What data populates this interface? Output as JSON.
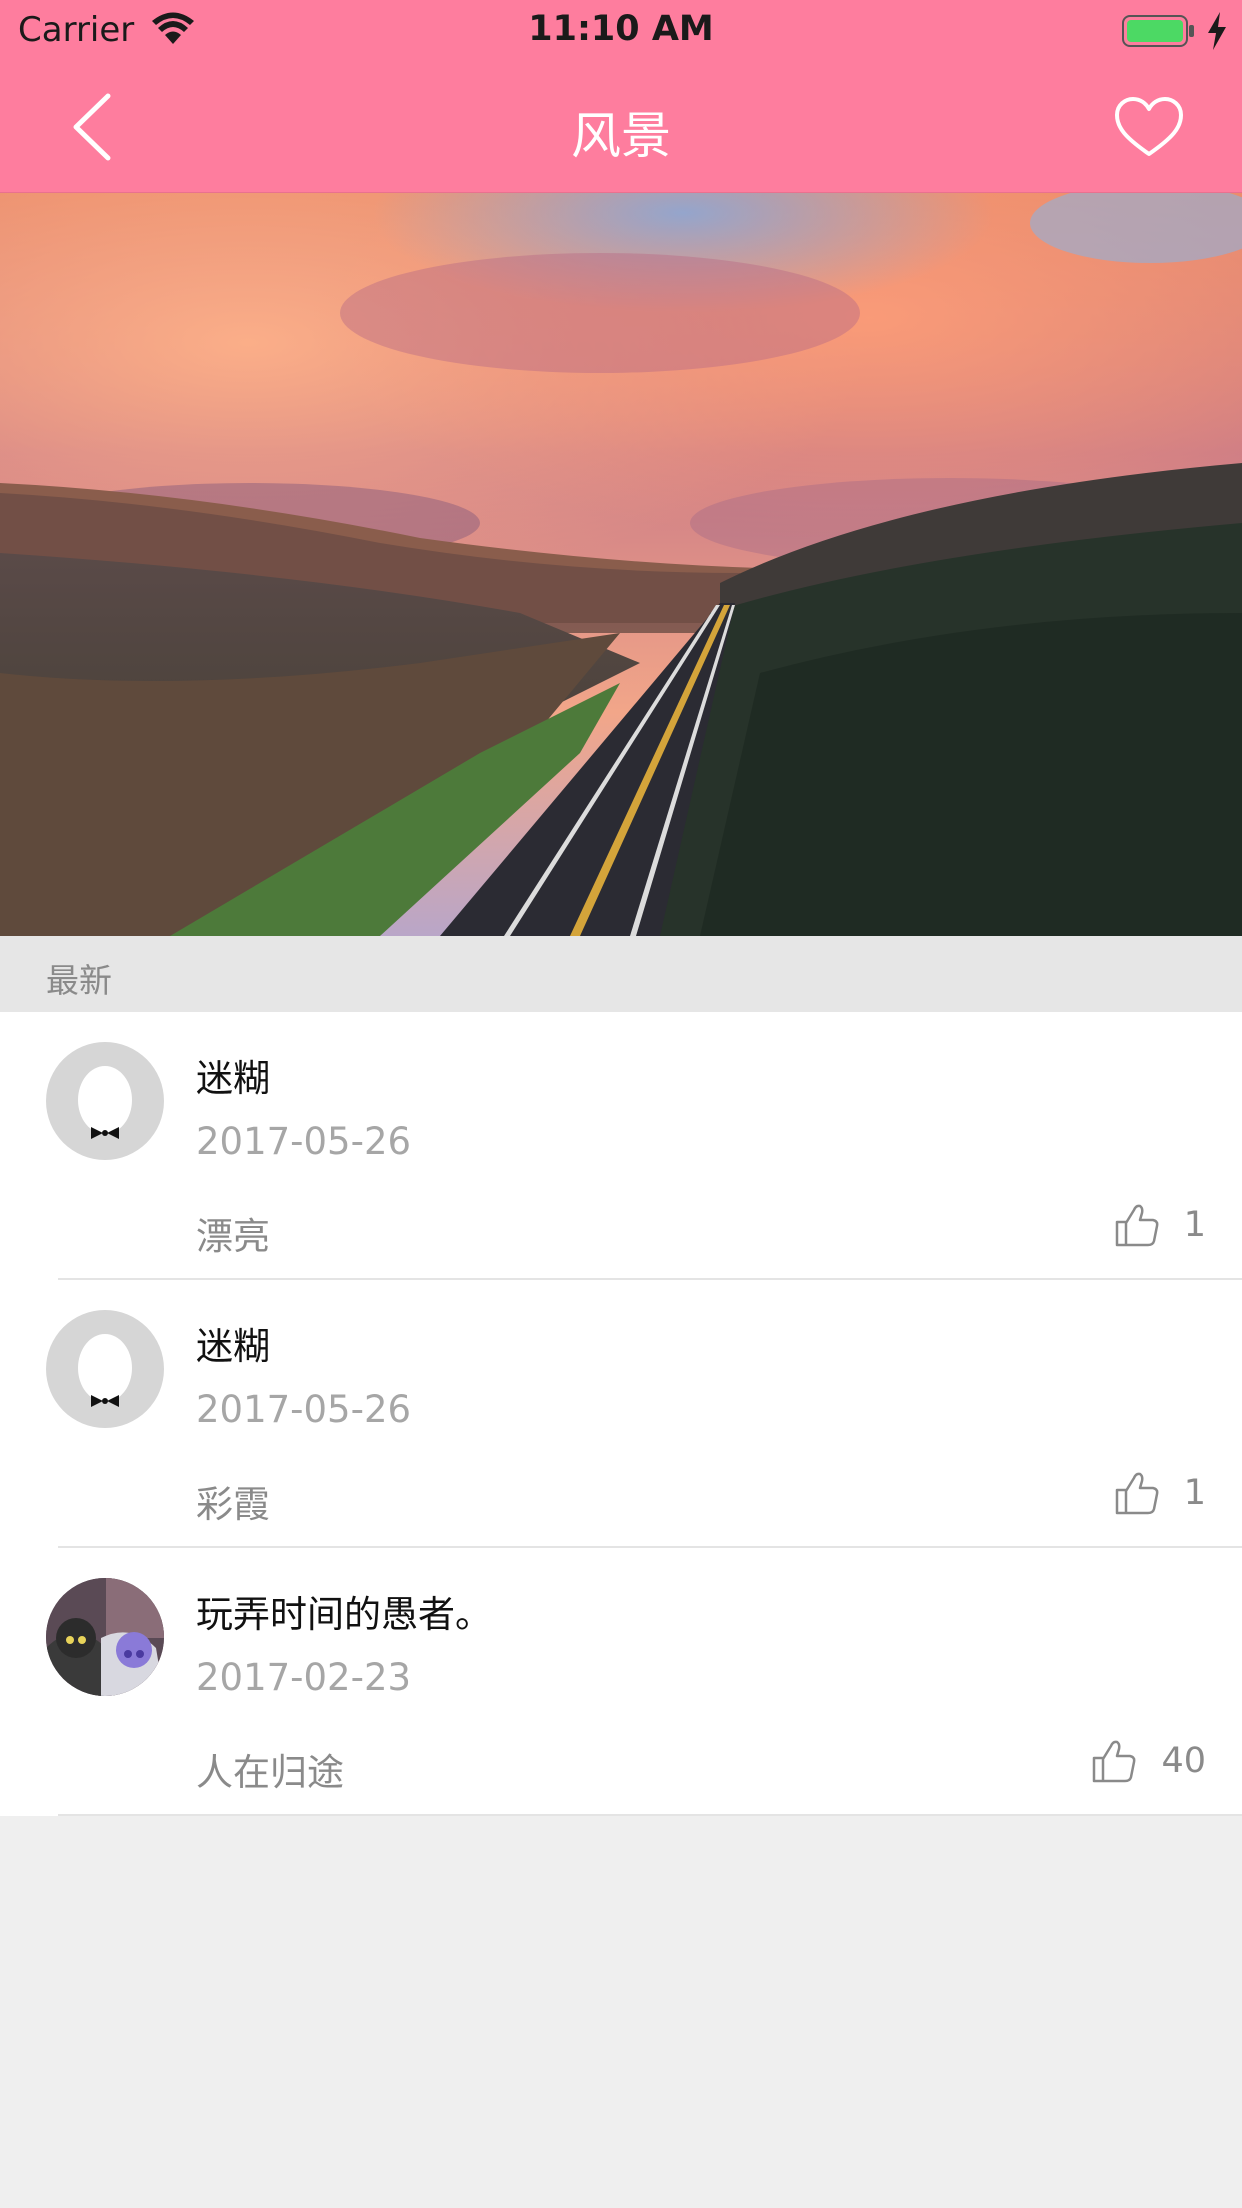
{
  "status_bar": {
    "carrier": "Carrier",
    "time": "11:10 AM"
  },
  "nav": {
    "title": "风景",
    "back_icon": "chevron-left-icon",
    "favorite_icon": "heart-outline-icon"
  },
  "colors": {
    "nav_background": "#fe7d9e",
    "list_background": "#ffffff",
    "page_background": "#efefef",
    "battery_fill": "#4cd964"
  },
  "hero_image": {
    "subject": "landscape-photo"
  },
  "section": {
    "title": "最新"
  },
  "comments": [
    {
      "name": "迷糊",
      "date": "2017-05-26",
      "content": "漂亮",
      "likes": "1",
      "avatar": "default-avatar"
    },
    {
      "name": "迷糊",
      "date": "2017-05-26",
      "content": "彩霞",
      "likes": "1",
      "avatar": "default-avatar"
    },
    {
      "name": "玩弄时间的愚者。",
      "date": "2017-02-23",
      "content": "人在归途",
      "likes": "40",
      "avatar": "anime-avatar"
    }
  ]
}
